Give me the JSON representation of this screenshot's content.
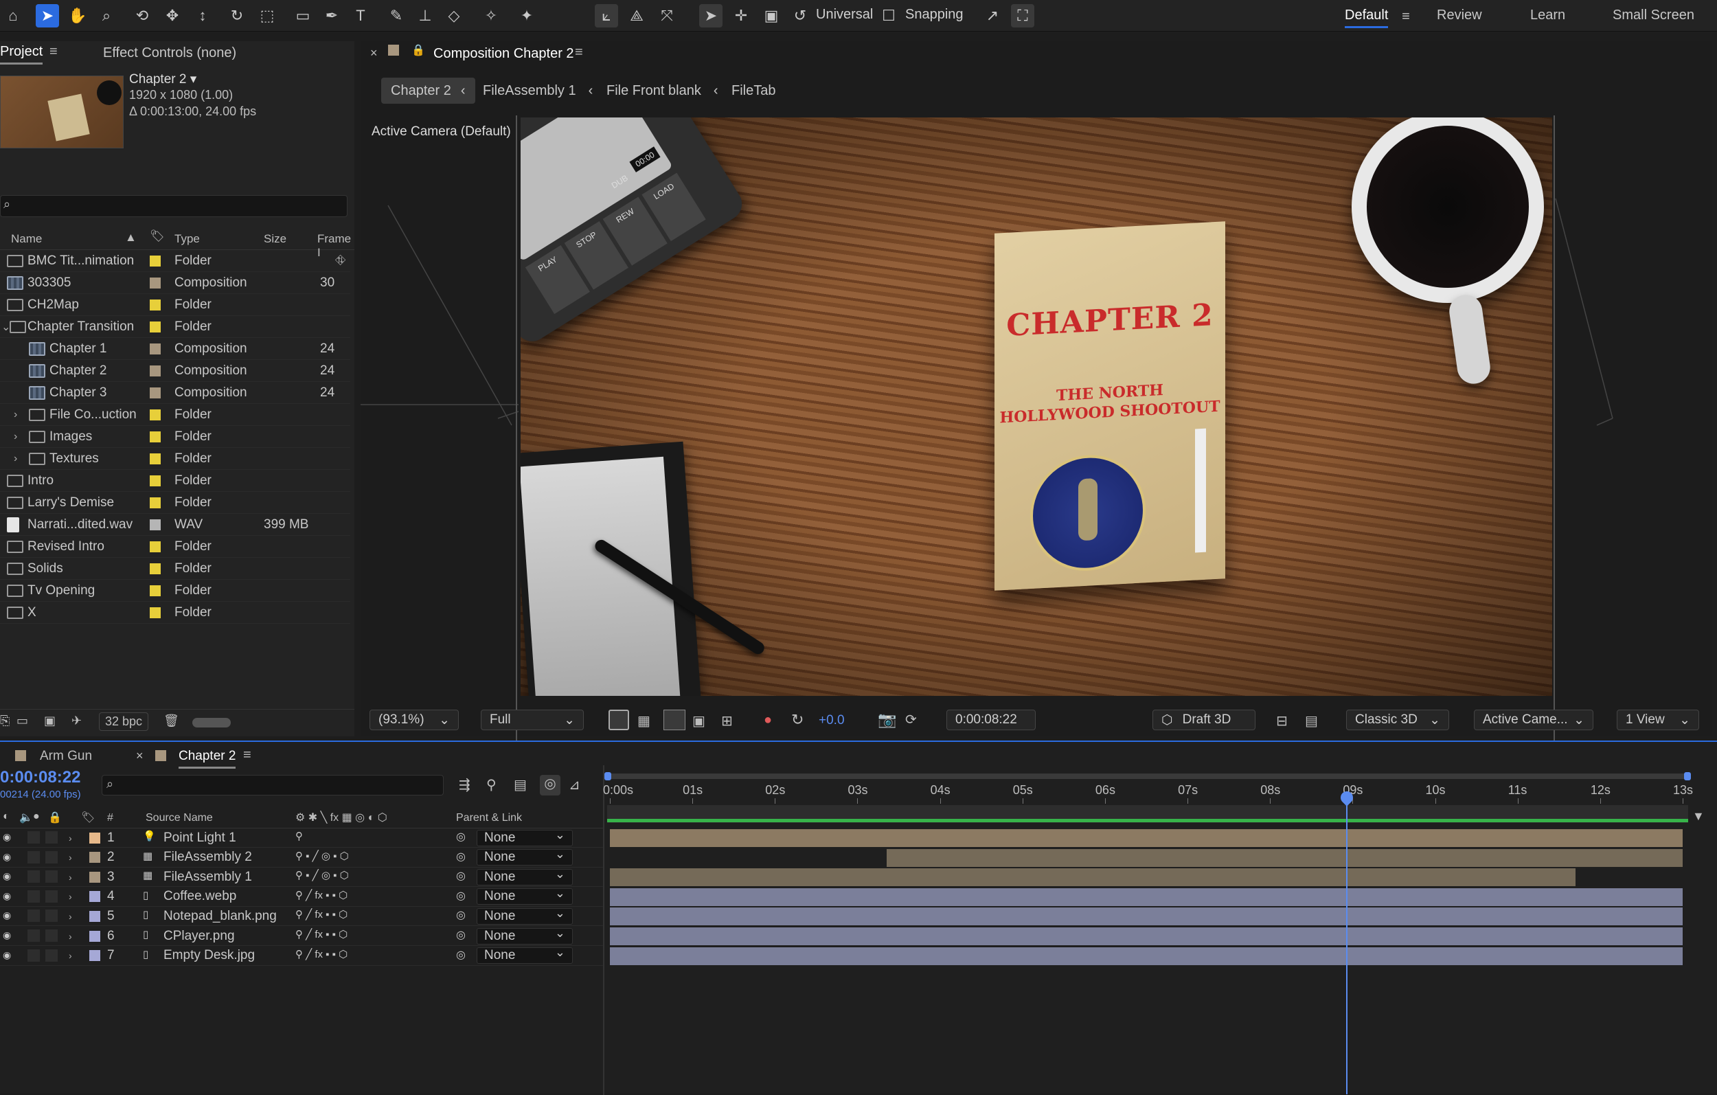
{
  "toolbar": {
    "mode_label": "Universal",
    "snapping_label": "Snapping",
    "workspaces": [
      "Default",
      "Review",
      "Learn",
      "Small Screen"
    ]
  },
  "project": {
    "tab_label": "Project",
    "effect_controls_label": "Effect Controls (none)",
    "preview_name": "Chapter 2 ▾",
    "preview_res": "1920 x 1080 (1.00)",
    "preview_dur": "Δ 0:00:13:00, 24.00 fps",
    "columns": {
      "name": "Name",
      "type": "Type",
      "size": "Size",
      "frame": "Frame I"
    },
    "bpc_label": "32 bpc",
    "items": [
      {
        "name": "BMC Tit...nimation",
        "type": "Folder",
        "size": "",
        "frame": "",
        "kind": "folder",
        "swatch": "#e7cf3a"
      },
      {
        "name": "303305",
        "type": "Composition",
        "size": "",
        "frame": "30",
        "kind": "comp",
        "swatch": "#a8977f"
      },
      {
        "name": "CH2Map",
        "type": "Folder",
        "size": "",
        "frame": "",
        "kind": "folder",
        "swatch": "#e7cf3a"
      },
      {
        "name": "Chapter Transition",
        "type": "Folder",
        "size": "",
        "frame": "",
        "kind": "folder",
        "swatch": "#e7cf3a"
      },
      {
        "name": "Chapter 1",
        "type": "Composition",
        "size": "",
        "frame": "24",
        "kind": "comp",
        "swatch": "#a8977f"
      },
      {
        "name": "Chapter 2",
        "type": "Composition",
        "size": "",
        "frame": "24",
        "kind": "comp",
        "swatch": "#a8977f"
      },
      {
        "name": "Chapter 3",
        "type": "Composition",
        "size": "",
        "frame": "24",
        "kind": "comp",
        "swatch": "#a8977f"
      },
      {
        "name": "File Co...uction",
        "type": "Folder",
        "size": "",
        "frame": "",
        "kind": "folder",
        "swatch": "#e7cf3a"
      },
      {
        "name": "Images",
        "type": "Folder",
        "size": "",
        "frame": "",
        "kind": "folder",
        "swatch": "#e7cf3a"
      },
      {
        "name": "Textures",
        "type": "Folder",
        "size": "",
        "frame": "",
        "kind": "folder",
        "swatch": "#e7cf3a"
      },
      {
        "name": "Intro",
        "type": "Folder",
        "size": "",
        "frame": "",
        "kind": "folder",
        "swatch": "#e7cf3a"
      },
      {
        "name": "Larry's Demise",
        "type": "Folder",
        "size": "",
        "frame": "",
        "kind": "folder",
        "swatch": "#e7cf3a"
      },
      {
        "name": "Narrati...dited.wav",
        "type": "WAV",
        "size": "399 MB",
        "frame": "",
        "kind": "wav",
        "swatch": "#b5b5b5"
      },
      {
        "name": "Revised Intro",
        "type": "Folder",
        "size": "",
        "frame": "",
        "kind": "folder",
        "swatch": "#e7cf3a"
      },
      {
        "name": "Solids",
        "type": "Folder",
        "size": "",
        "frame": "",
        "kind": "folder",
        "swatch": "#e7cf3a"
      },
      {
        "name": "Tv Opening",
        "type": "Folder",
        "size": "",
        "frame": "",
        "kind": "folder",
        "swatch": "#e7cf3a"
      },
      {
        "name": "X",
        "type": "Folder",
        "size": "",
        "frame": "",
        "kind": "folder",
        "swatch": "#e7cf3a"
      }
    ]
  },
  "viewer": {
    "tab_label": "Composition Chapter 2",
    "breadcrumbs": [
      "Chapter 2",
      "FileAssembly 1",
      "File Front blank",
      "FileTab"
    ],
    "camera_label": "Active Camera (Default)",
    "folder_title": "CHAPTER 2",
    "folder_subtitle_1": "THE NORTH",
    "folder_subtitle_2": "HOLLYWOOD SHOOTOUT",
    "recorder_keys": [
      "PLAY",
      "STOP",
      "REW",
      "LOAD",
      "DUB"
    ],
    "recorder_counter": "00:00",
    "zoom": "(93.1%)",
    "resolution": "Full",
    "exposure": "+0.0",
    "timecode": "0:00:08:22",
    "draft3d_label": "Draft 3D",
    "renderer": "Classic 3D",
    "camera_select": "Active Came...",
    "views": "1 View"
  },
  "timeline": {
    "tabs": [
      "Arm Gun",
      "Chapter 2"
    ],
    "timecode": "0:00:08:22",
    "frame_info": "00214 (24.00 fps)",
    "col_source": "Source Name",
    "col_parent": "Parent & Link",
    "ruler": [
      "0:00s",
      "01s",
      "02s",
      "03s",
      "04s",
      "05s",
      "06s",
      "07s",
      "08s",
      "09s",
      "10s",
      "11s",
      "12s",
      "13s"
    ],
    "layers": [
      {
        "num": "1",
        "name": "Point Light 1",
        "label": "#e7b98a",
        "parent": "None",
        "kind": "light",
        "bar": "#8c7a62",
        "start": 0,
        "end": 13
      },
      {
        "num": "2",
        "name": "FileAssembly 2",
        "label": "#a8977f",
        "parent": "None",
        "kind": "comp",
        "bar": "#756a58",
        "start": 3.35,
        "end": 13
      },
      {
        "num": "3",
        "name": "FileAssembly 1",
        "label": "#a8977f",
        "parent": "None",
        "kind": "comp",
        "bar": "#756a58",
        "start": 0,
        "end": 11.7
      },
      {
        "num": "4",
        "name": "Coffee.webp",
        "label": "#a5a8d6",
        "parent": "None",
        "kind": "file",
        "bar": "#7b7f9a",
        "start": 0,
        "end": 13
      },
      {
        "num": "5",
        "name": "Notepad_blank.png",
        "label": "#a5a8d6",
        "parent": "None",
        "kind": "file",
        "bar": "#7b7f9a",
        "start": 0,
        "end": 13
      },
      {
        "num": "6",
        "name": "CPlayer.png",
        "label": "#a5a8d6",
        "parent": "None",
        "kind": "file",
        "bar": "#7b7f9a",
        "start": 0,
        "end": 13
      },
      {
        "num": "7",
        "name": "Empty Desk.jpg",
        "label": "#a5a8d6",
        "parent": "None",
        "kind": "file",
        "bar": "#7b7f9a",
        "start": 0,
        "end": 13
      }
    ],
    "playhead_seconds": 8.92,
    "duration_seconds": 13
  }
}
